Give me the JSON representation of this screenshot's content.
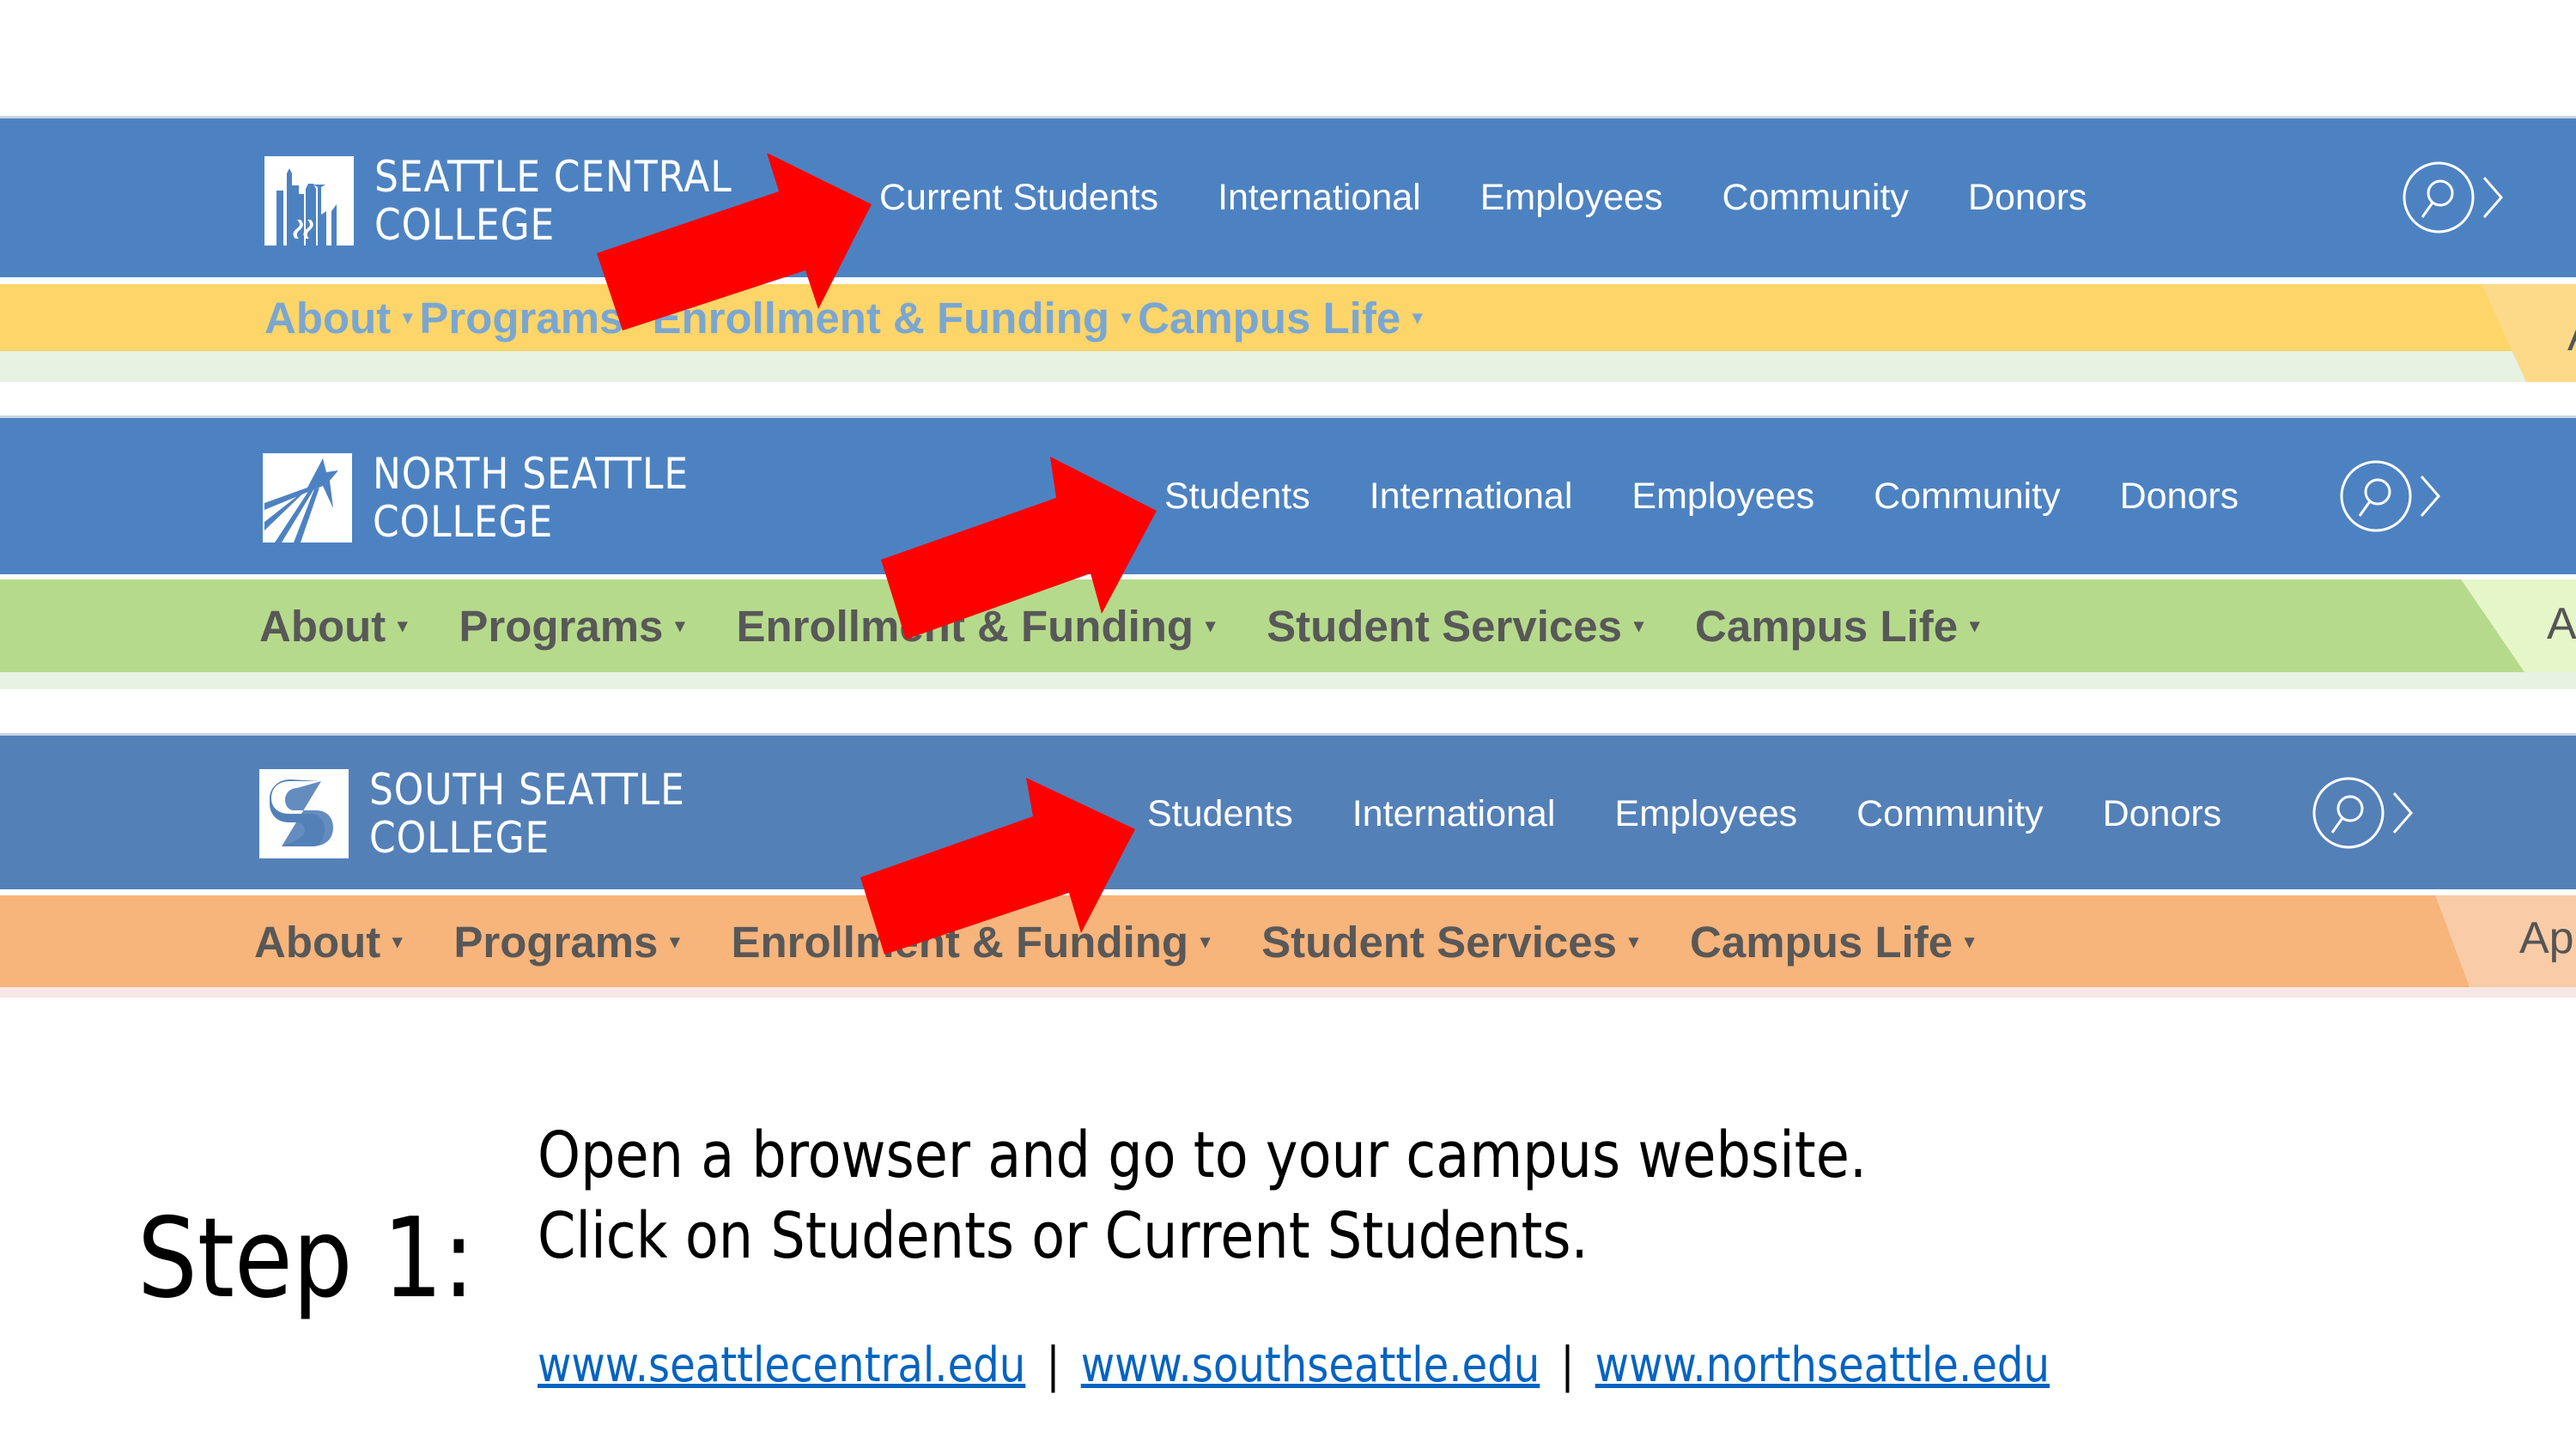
{
  "colors": {
    "top_bar_blue": "#4d82c2",
    "south_top_bar_blue": "#5480b8",
    "central_subbar": "#fed569",
    "central_subnav_text": "#7aa7d1",
    "north_subbar": "#b6da8c",
    "south_subbar": "#f7b47b",
    "subnav_text_dark": "#585858",
    "arrow_red": "#ff0000",
    "link_blue": "#0563c1"
  },
  "sites": [
    {
      "id": "seattle-central",
      "logo_line1": "SEATTLE CENTRAL",
      "logo_line2": "COLLEGE",
      "logo_icon": "skyline-icon",
      "top_nav": [
        "Current Students",
        "International",
        "Employees",
        "Community",
        "Donors"
      ],
      "search_icon": "search-icon",
      "search_chevron": "chevron-right-icon",
      "sub_nav": [
        "About",
        "Programs",
        "Enrollment & Funding",
        "Campus Life"
      ],
      "apply_label": "A"
    },
    {
      "id": "north-seattle",
      "logo_line1": "NORTH SEATTLE",
      "logo_line2": "COLLEGE",
      "logo_icon": "star-burst-icon",
      "top_nav": [
        "Students",
        "International",
        "Employees",
        "Community",
        "Donors"
      ],
      "search_icon": "search-icon",
      "search_chevron": "chevron-right-icon",
      "sub_nav": [
        "About",
        "Programs",
        "Enrollment & Funding",
        "Student Services",
        "Campus Life"
      ],
      "apply_label": "Ap"
    },
    {
      "id": "south-seattle",
      "logo_line1": "SOUTH SEATTLE",
      "logo_line2": "COLLEGE",
      "logo_icon": "s-letter-icon",
      "top_nav": [
        "Students",
        "International",
        "Employees",
        "Community",
        "Donors"
      ],
      "search_icon": "search-icon",
      "search_chevron": "chevron-right-icon",
      "sub_nav": [
        "About",
        "Programs",
        "Enrollment & Funding",
        "Student Services",
        "Campus Life"
      ],
      "apply_label": "App"
    }
  ],
  "caret_glyph": "▾",
  "instructions": {
    "step_label": "Step 1:",
    "line1": "Open a browser and go to your campus website.",
    "line2_prefix": "Click on ",
    "line2_students": "Students",
    "line2_or": " or ",
    "line2_current": "Current Students",
    "line2_suffix": ".",
    "links": [
      "www.seattlecentral.edu",
      "www.southseattle.edu",
      "www.northseattle.edu"
    ],
    "separator": "|"
  }
}
